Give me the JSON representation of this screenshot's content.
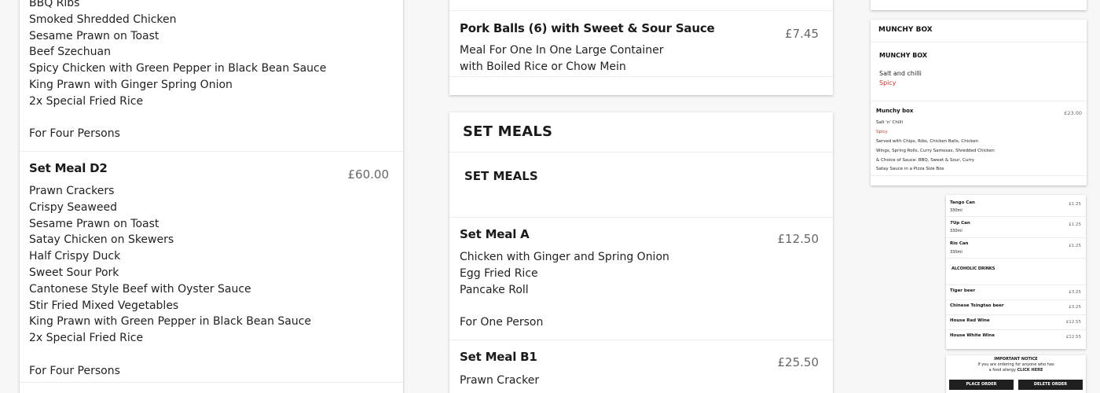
{
  "left": {
    "first_lines": [
      "BBQ Ribs",
      "Smoked Shredded Chicken",
      "Sesame Prawn on Toast",
      "Beef Szechuan",
      "Spicy Chicken with Green Pepper in Black Bean Sauce",
      "King Prawn with Ginger Spring Onion",
      "2x Special Fried Rice"
    ],
    "first_persons": "For Four Persons",
    "d2": {
      "title": "Set Meal D2",
      "price": "£60.00",
      "lines": [
        "Prawn Crackers",
        "Crispy Seaweed",
        "Sesame Prawn on Toast",
        "Satay Chicken on Skewers",
        "Half Crispy Duck",
        "Sweet Sour Pork",
        "Cantonese Style Beef with Oyster Sauce",
        "Stir Fried Mixed Vegetables",
        "King Prawn with Green Pepper in Black Bean Sauce",
        "2x Special Fried Rice"
      ],
      "persons": "For Four Persons"
    }
  },
  "middle": {
    "pork_balls": {
      "title": "Pork Balls (6) with Sweet & Sour Sauce",
      "price": "£7.45",
      "line1": "Meal For One In One Large Container",
      "line2": "with Boiled Rice or Chow Mein"
    },
    "set_meals_header": "SET MEALS",
    "set_meals_sub": "SET MEALS",
    "meal_a": {
      "title": "Set Meal A",
      "price": "£12.50",
      "lines": [
        "Chicken with Ginger and Spring Onion",
        "Egg Fried Rice",
        "Pancake Roll"
      ],
      "persons": "For One Person"
    },
    "meal_b1": {
      "title": "Set Meal B1",
      "price": "£25.50",
      "lines": [
        "Prawn Cracker"
      ]
    }
  },
  "right": {
    "munchy_header": "MUNCHY BOX",
    "munchy_sub": "MUNCHY BOX",
    "salt_chilli": "Salt and chilli",
    "spicy1": "Spicy",
    "munchy_item": {
      "title": "Munchy box",
      "price": "£23.00",
      "line1": "Salt 'n' Chilli",
      "spicy": "Spicy",
      "desc": [
        "Served with Chips, Ribs, Chicken Balls, Chicken",
        "Wings, Spring Rolls, Curry Samosas, Shredded Chicken",
        "& Choice of Sauce: BBQ, Sweet & Sour, Curry",
        "Satay Sauce in a Pizza Size Box"
      ]
    },
    "drinks": [
      {
        "name": "Tango Can",
        "size": "330ml",
        "price": "£1.25"
      },
      {
        "name": "7Up Can",
        "size": "330ml",
        "price": "£1.25"
      },
      {
        "name": "Rio Can",
        "size": "330ml",
        "price": "£1.25"
      }
    ],
    "alcoholic_header": "ALCOHOLIC DRINKS",
    "alcoholic": [
      {
        "name": "Tiger beer",
        "price": "£3.25"
      },
      {
        "name": "Chinese Tsingtao beer",
        "price": "£3.25"
      },
      {
        "name": "House Red Wine",
        "price": "£12.55"
      },
      {
        "name": "House White Wine",
        "price": "£12.55"
      }
    ],
    "notice": {
      "title": "IMPORTANT NOTICE",
      "line1": "If you are ordering for anyone who has",
      "line2_pre": "a food allergy",
      "line2_link": "CLICK HERE",
      "place_order": "PLACE ORDER",
      "delete_order": "DELETE ORDER"
    }
  }
}
